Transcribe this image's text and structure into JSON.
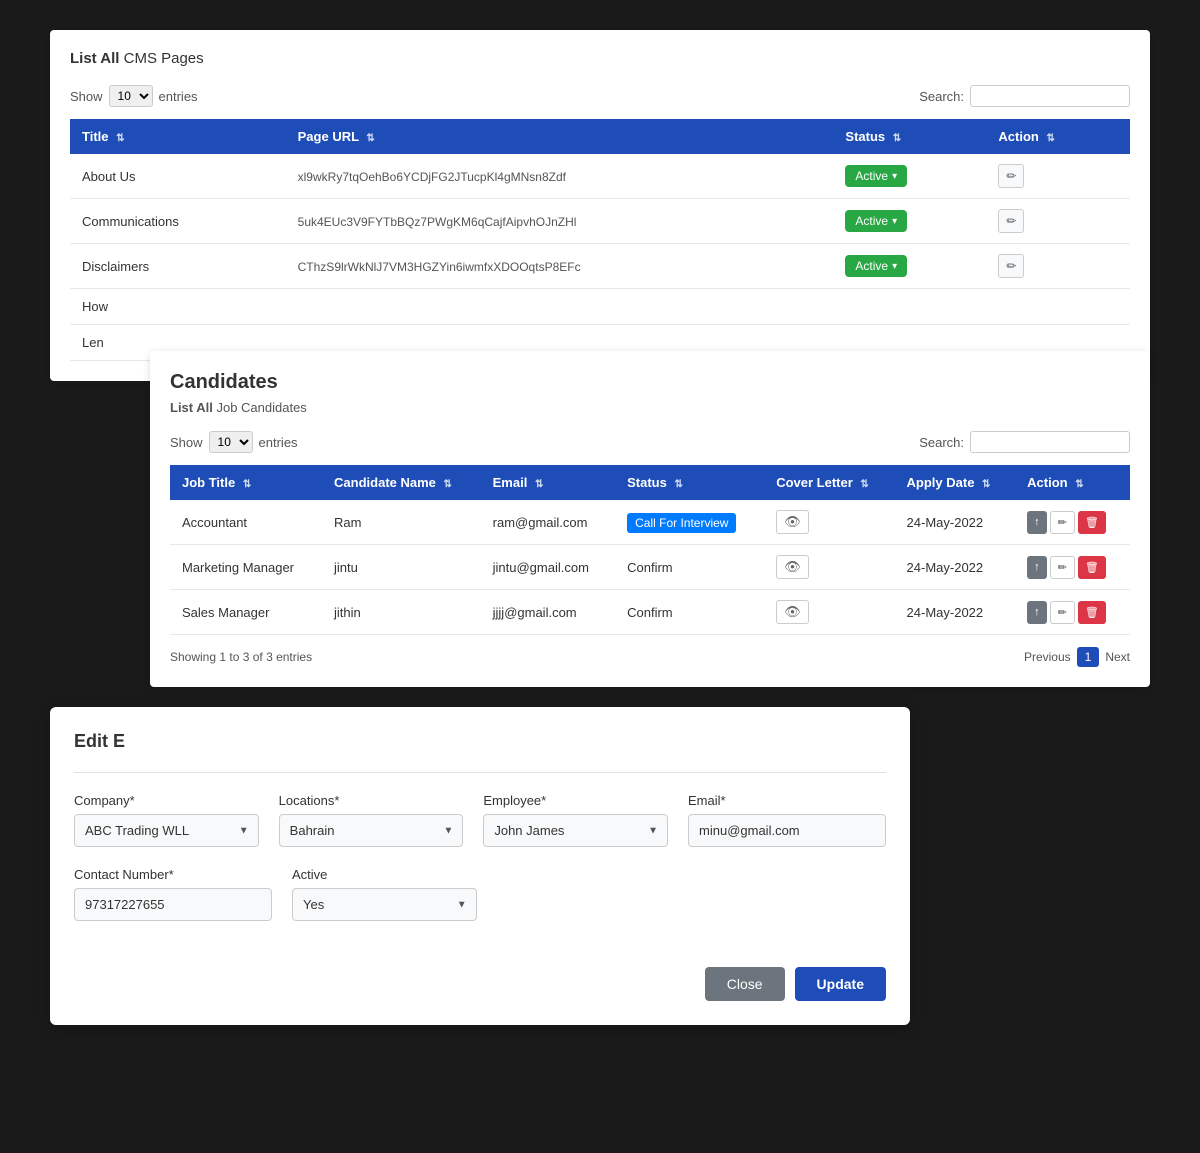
{
  "cms_panel": {
    "title_bold": "List All",
    "title_normal": " CMS Pages",
    "show_label": "Show",
    "entries_label": "entries",
    "show_count": "10",
    "search_label": "Search:",
    "columns": [
      "Title",
      "Page URL",
      "Status",
      "Action"
    ],
    "rows": [
      {
        "title": "About Us",
        "url": "xl9wkRy7tqOehBo6YCDjFG2JTucpKl4gMNsn8Zdf",
        "status": "Active",
        "status_color": "#28a745"
      },
      {
        "title": "Communications",
        "url": "5uk4EUc3V9FYTbBQz7PWgKM6qCajfAipvhOJnZHl",
        "status": "Active",
        "status_color": "#28a745"
      },
      {
        "title": "Disclaimers",
        "url": "CThzS9lrWkNlJ7VM3HGZYin6iwmfxXDOOqtsP8EFc",
        "status": "Active",
        "status_color": "#28a745"
      },
      {
        "title": "How",
        "url": "",
        "status": "",
        "status_color": ""
      },
      {
        "title": "Len",
        "url": "",
        "status": "",
        "status_color": ""
      }
    ]
  },
  "candidates_panel": {
    "heading": "Candidates",
    "subtitle_bold": "List All",
    "subtitle_normal": " Job Candidates",
    "show_label": "Show",
    "entries_label": "entries",
    "show_count": "10",
    "search_label": "Search:",
    "columns": [
      "Job Title",
      "Candidate Name",
      "Email",
      "Status",
      "Cover Letter",
      "Apply Date",
      "Action"
    ],
    "rows": [
      {
        "job_title": "Accountant",
        "candidate_name": "Ram",
        "email": "ram@gmail.com",
        "status": "Call For Interview",
        "status_type": "call",
        "apply_date": "24-May-2022"
      },
      {
        "job_title": "Marketing Manager",
        "candidate_name": "jintu",
        "email": "jintu@gmail.com",
        "status": "Confirm",
        "status_type": "confirm",
        "apply_date": "24-May-2022"
      },
      {
        "job_title": "Sales Manager",
        "candidate_name": "jithin",
        "email": "jjjj@gmail.com",
        "status": "Confirm",
        "status_type": "confirm",
        "apply_date": "24-May-2022"
      }
    ],
    "footer_text": "Showing 1 to 3 of 3 entries",
    "prev_label": "Previous",
    "next_label": "Next",
    "current_page": "1"
  },
  "edit_modal": {
    "title": "Edit E",
    "company_label": "Company*",
    "company_value": "ABC Trading WLL",
    "location_label": "Locations*",
    "location_value": "Bahrain",
    "employee_label": "Employee*",
    "employee_value": "John James",
    "email_label": "Email*",
    "email_value": "minu@gmail.com",
    "contact_label": "Contact Number*",
    "contact_value": "97317227655",
    "active_label": "Active",
    "active_value": "Yes",
    "close_label": "Close",
    "update_label": "Update"
  }
}
